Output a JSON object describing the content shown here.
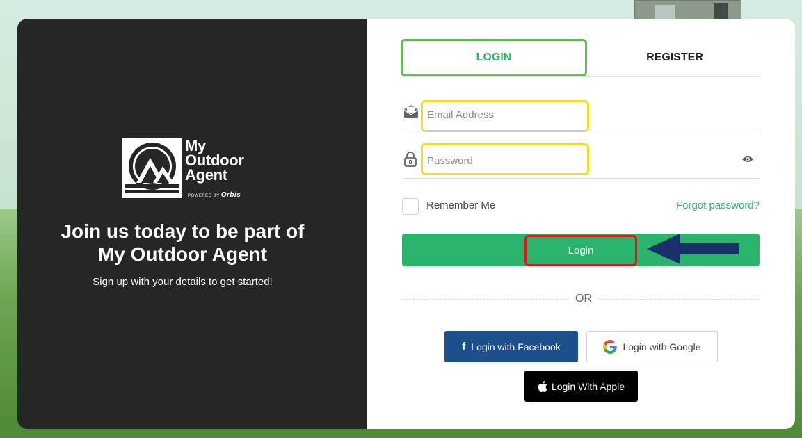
{
  "left_panel": {
    "logo": {
      "line1": "My",
      "line2": "Outdoor",
      "line3": "Agent",
      "powered_by": "POWERED BY",
      "powered_brand": "Orbis"
    },
    "headline_line1": "Join us today to be part of",
    "headline_line2": "My Outdoor Agent",
    "subtext": "Sign up with your details to get started!"
  },
  "tabs": [
    {
      "label": "LOGIN",
      "active": true
    },
    {
      "label": "REGISTER",
      "active": false
    }
  ],
  "form": {
    "email_placeholder": "Email Address",
    "email_value": "",
    "password_placeholder": "Password",
    "password_value": "",
    "remember_label": "Remember Me",
    "remember_checked": false,
    "forgot_label": "Forgot password?",
    "login_label": "Login"
  },
  "divider_label": "OR",
  "social": {
    "facebook_label": "Login with Facebook",
    "google_label": "Login with Google",
    "apple_label": "Login With Apple"
  },
  "colors": {
    "accent_green": "#29b36b",
    "left_panel_bg": "#262626",
    "facebook_blue": "#1d4f8a",
    "highlight_tab": "#5cc04f",
    "highlight_field": "#f2dd2a",
    "highlight_button": "#e3141e",
    "annotation_arrow": "#1b2f6b"
  },
  "icons": [
    "email-icon",
    "lock-icon",
    "eye-icon",
    "facebook-icon",
    "google-icon",
    "apple-icon",
    "arrow-annotation-icon"
  ]
}
